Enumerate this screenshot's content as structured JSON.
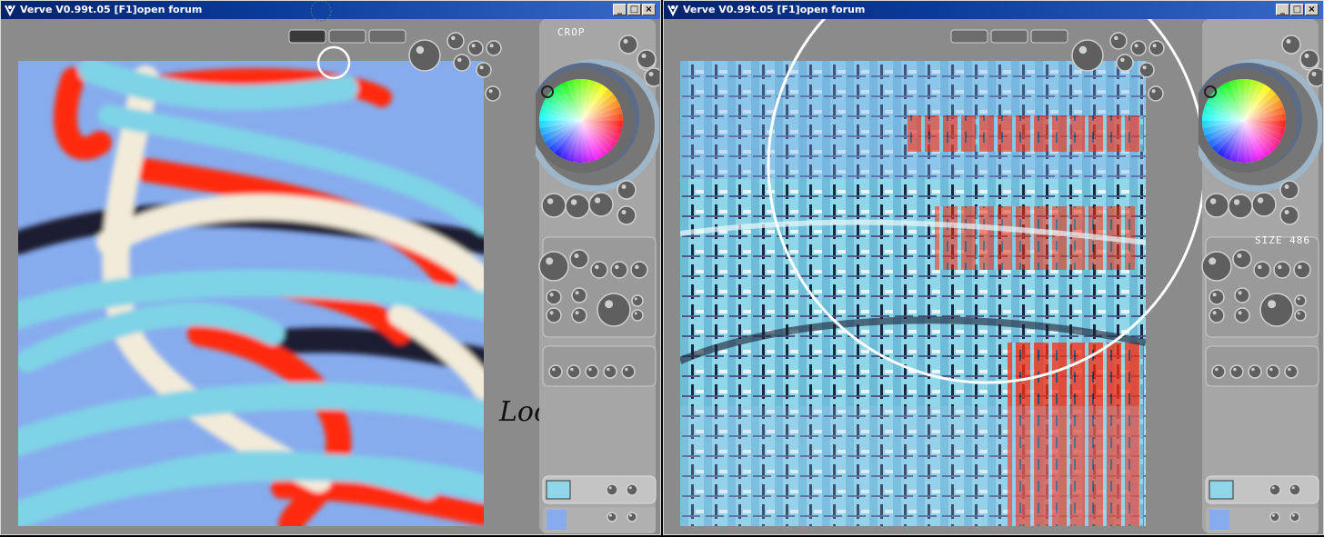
{
  "windows": [
    {
      "id": "left",
      "title": "Verve V0.99t.05 [F1]open forum",
      "panel_label": "CROP",
      "handwritten_note": "Local + BG"
    },
    {
      "id": "right",
      "title": "Verve V0.99t.05 [F1]open forum",
      "panel_label": "SIZE 486"
    }
  ],
  "titlebar_buttons": {
    "minimize": "_",
    "maximize": "□",
    "close": "×"
  },
  "colors": {
    "titlebar": "#0a3a9a",
    "window_bg": "#8b8b8b",
    "canvas_bg": "#87acee",
    "cyan_stroke": "#7fd3e6",
    "red_stroke": "#ff2a0a",
    "cream_stroke": "#f3ebd9",
    "dark_stroke": "#1d1f33"
  },
  "icons": {
    "app": "verve-app-icon",
    "color_wheel": "color-wheel-icon",
    "brush_cursor": "brush-cursor-icon"
  }
}
